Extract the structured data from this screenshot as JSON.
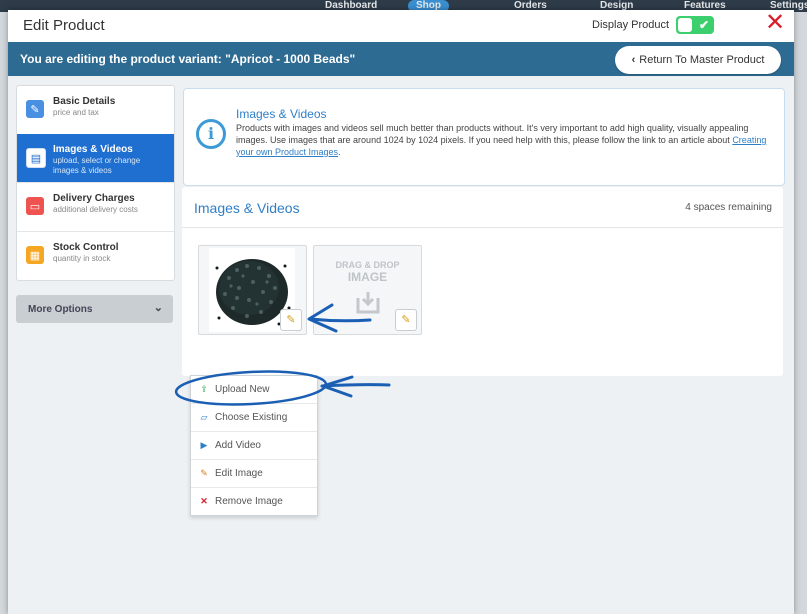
{
  "background_nav": {
    "dashboard": "Dashboard",
    "shop": "Shop",
    "orders": "Orders",
    "design": "Design",
    "features": "Features",
    "settings": "Settings"
  },
  "modal": {
    "title": "Edit Product",
    "display_product_label": "Display Product",
    "display_product_on": true,
    "close_symbol": "✕"
  },
  "variant_bar": {
    "text": "You are editing the product variant: \"Apricot - 1000 Beads\"",
    "return_button": "Return To Master Product"
  },
  "sidebar": {
    "items": [
      {
        "label": "Basic Details",
        "sub": "price and tax",
        "icon": "pencil-icon",
        "active": false
      },
      {
        "label": "Images & Videos",
        "sub": "upload, select or change images & videos",
        "icon": "image-file-icon",
        "active": true
      },
      {
        "label": "Delivery Charges",
        "sub": "additional delivery costs",
        "icon": "truck-icon",
        "active": false
      },
      {
        "label": "Stock Control",
        "sub": "quantity in stock",
        "icon": "stock-icon",
        "active": false
      }
    ],
    "more_options": "More Options"
  },
  "info": {
    "title": "Images & Videos",
    "body": "Products with images and videos sell much better than products without. It's very important to add high quality, visually appealing images. Use images that are around 1024 by 1024 pixels. If you need help with this, please follow the link to an article about",
    "link": "Creating your own Product Images",
    "end": "."
  },
  "panel": {
    "title": "Images & Videos",
    "spaces": "4 spaces remaining",
    "drag_drop_line1": "DRAG & DROP",
    "drag_drop_line2": "IMAGE"
  },
  "menu": {
    "items": [
      {
        "label": "Upload New",
        "icon": "upload-icon",
        "color": "#2ea84f"
      },
      {
        "label": "Choose Existing",
        "icon": "folder-icon",
        "color": "#2f7fc7"
      },
      {
        "label": "Add Video",
        "icon": "video-icon",
        "color": "#2f7fc7"
      },
      {
        "label": "Edit Image",
        "icon": "edit-icon",
        "color": "#e07b1f"
      },
      {
        "label": "Remove Image",
        "icon": "remove-icon",
        "color": "#d91e2b"
      }
    ]
  },
  "colors": {
    "accent_blue": "#1f6fd0",
    "variant_bar": "#2e6b92",
    "toggle_on": "#3ccf6e",
    "close_red": "#d91e2b",
    "annotation": "#1a5fb4"
  }
}
